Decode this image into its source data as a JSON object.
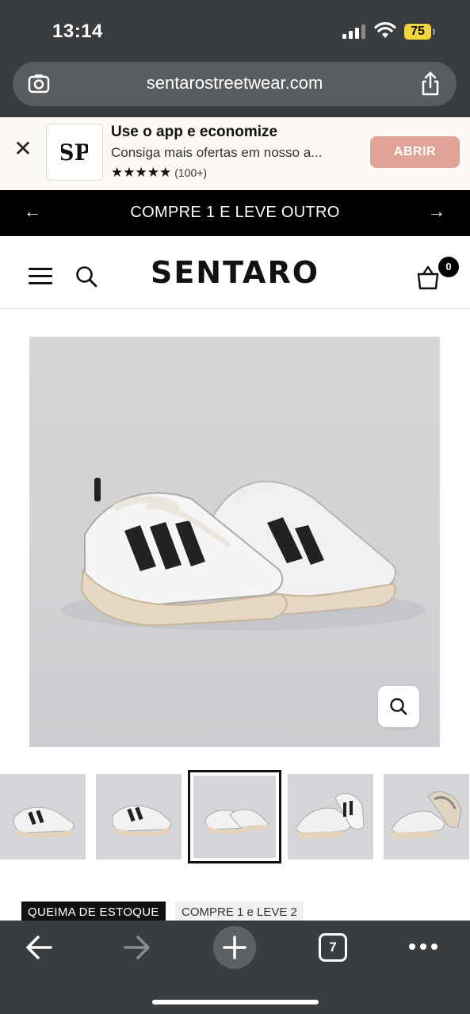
{
  "status_bar": {
    "time": "13:14",
    "battery": "75",
    "battery_color": "#f2d43c"
  },
  "browser": {
    "url": "sentarostreetwear.com",
    "open_tabs": "7"
  },
  "app_banner": {
    "title": "Use o app e economize",
    "subtitle": "Consiga mais ofertas em nosso a...",
    "stars": "★★★★★",
    "rating_count": "(100+)",
    "open_label": "ABRIR",
    "open_color": "#e0a396",
    "logo_text": "SP"
  },
  "promo": {
    "text": "COMPRE 1 E LEVE OUTRO"
  },
  "header": {
    "logo": "SENTARO",
    "cart_count": "0"
  },
  "gallery": {
    "thumbnail_count": 5,
    "active_index": 2
  },
  "tags": {
    "sale": "QUEIMA DE ESTOQUE",
    "offer": "COMPRE 1 e LEVE 2"
  },
  "icons": {
    "close": "close-icon",
    "menu": "hamburger-menu-icon",
    "search": "search-icon",
    "cart": "shopping-bag-icon",
    "zoom": "zoom-icon",
    "share": "share-icon",
    "back": "arrow-left-icon",
    "forward": "arrow-right-icon",
    "new_tab": "plus-icon",
    "more": "more-dots-icon"
  }
}
